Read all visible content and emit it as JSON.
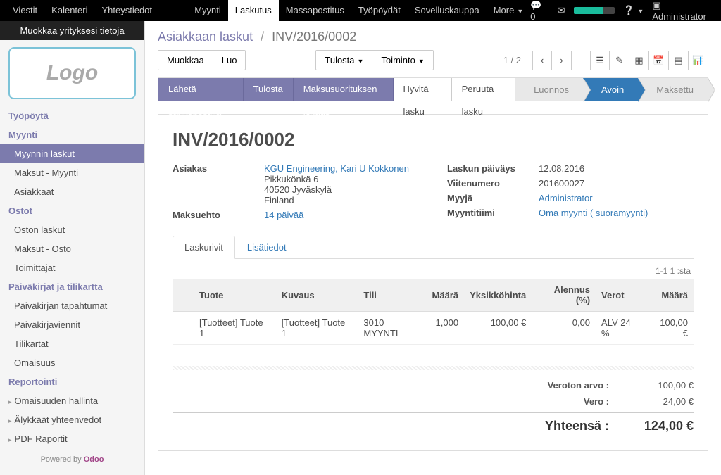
{
  "topnav": {
    "items": [
      "Viestit",
      "Kalenteri",
      "Yhteystiedot (CRM)",
      "Myynti",
      "Laskutus",
      "Massapostitus",
      "Työpöydät",
      "Sovelluskauppa",
      "More"
    ],
    "active_index": 4,
    "msg_count": "0",
    "user": "Administrator"
  },
  "sidebar": {
    "banner": "Muokkaa yrityksesi tietoja",
    "logo": "Logo",
    "sections": [
      {
        "title": "Työpöytä",
        "items": []
      },
      {
        "title": "Myynti",
        "items": [
          "Myynnin laskut",
          "Maksut - Myynti",
          "Asiakkaat"
        ],
        "active": 0
      },
      {
        "title": "Ostot",
        "items": [
          "Oston laskut",
          "Maksut - Osto",
          "Toimittajat"
        ]
      },
      {
        "title": "Päiväkirjat ja tilikartta",
        "items": [
          "Päiväkirjan tapahtumat",
          "Päiväkirjaviennit",
          "Tilikartat",
          "Omaisuus"
        ]
      },
      {
        "title": "Reportointi",
        "items": [
          "Omaisuuden hallinta",
          "Älykkäät yhteenvedot",
          "PDF Raportit"
        ]
      }
    ],
    "powered_pre": "Powered by ",
    "powered_link": "Odoo"
  },
  "breadcrumb": {
    "root": "Asiakkaan laskut",
    "current": "INV/2016/0002"
  },
  "toolbar": {
    "edit": "Muokkaa",
    "create": "Luo",
    "print": "Tulosta",
    "action": "Toiminto",
    "pager": "1 / 2"
  },
  "statusbar": {
    "buttons": [
      "Lähetä sähköpostilla",
      "Tulosta",
      "Maksusuorituksen kirjaus",
      "Hyvitä lasku",
      "Peruuta lasku"
    ],
    "steps": [
      "Luonnos",
      "Avoin",
      "Maksettu"
    ],
    "active_step": 1
  },
  "invoice": {
    "title": "INV/2016/0002",
    "customer_label": "Asiakas",
    "customer_name": "KGU Engineering, Kari U Kokkonen",
    "customer_addr": [
      "Pikkukönkä 6",
      "40520 Jyväskylä",
      "Finland"
    ],
    "term_label": "Maksuehto",
    "term_value": "14 päivää",
    "date_label": "Laskun päiväys",
    "date_value": "12.08.2016",
    "ref_label": "Viitenumero",
    "ref_value": "201600027",
    "seller_label": "Myyjä",
    "seller_value": "Administrator",
    "team_label": "Myyntitiimi",
    "team_value": "Oma myynti ( suoramyynti)"
  },
  "tabs": {
    "lines": "Laskurivit",
    "extra": "Lisätiedot"
  },
  "range": "1-1 1 :sta",
  "table": {
    "headers": [
      "Tuote",
      "Kuvaus",
      "Tili",
      "Määrä",
      "Yksikköhinta",
      "Alennus (%)",
      "Verot",
      "Määrä"
    ],
    "rows": [
      {
        "product": "[Tuotteet] Tuote 1",
        "desc": "[Tuotteet] Tuote 1",
        "account": "3010 MYYNTI",
        "qty": "1,000",
        "price": "100,00 €",
        "disc": "0,00",
        "tax": "ALV 24 %",
        "amount": "100,00 €"
      }
    ]
  },
  "totals": {
    "untaxed_label": "Veroton arvo :",
    "untaxed_value": "100,00 €",
    "tax_label": "Vero :",
    "tax_value": "24,00 €",
    "total_label": "Yhteensä :",
    "total_value": "124,00 €"
  }
}
